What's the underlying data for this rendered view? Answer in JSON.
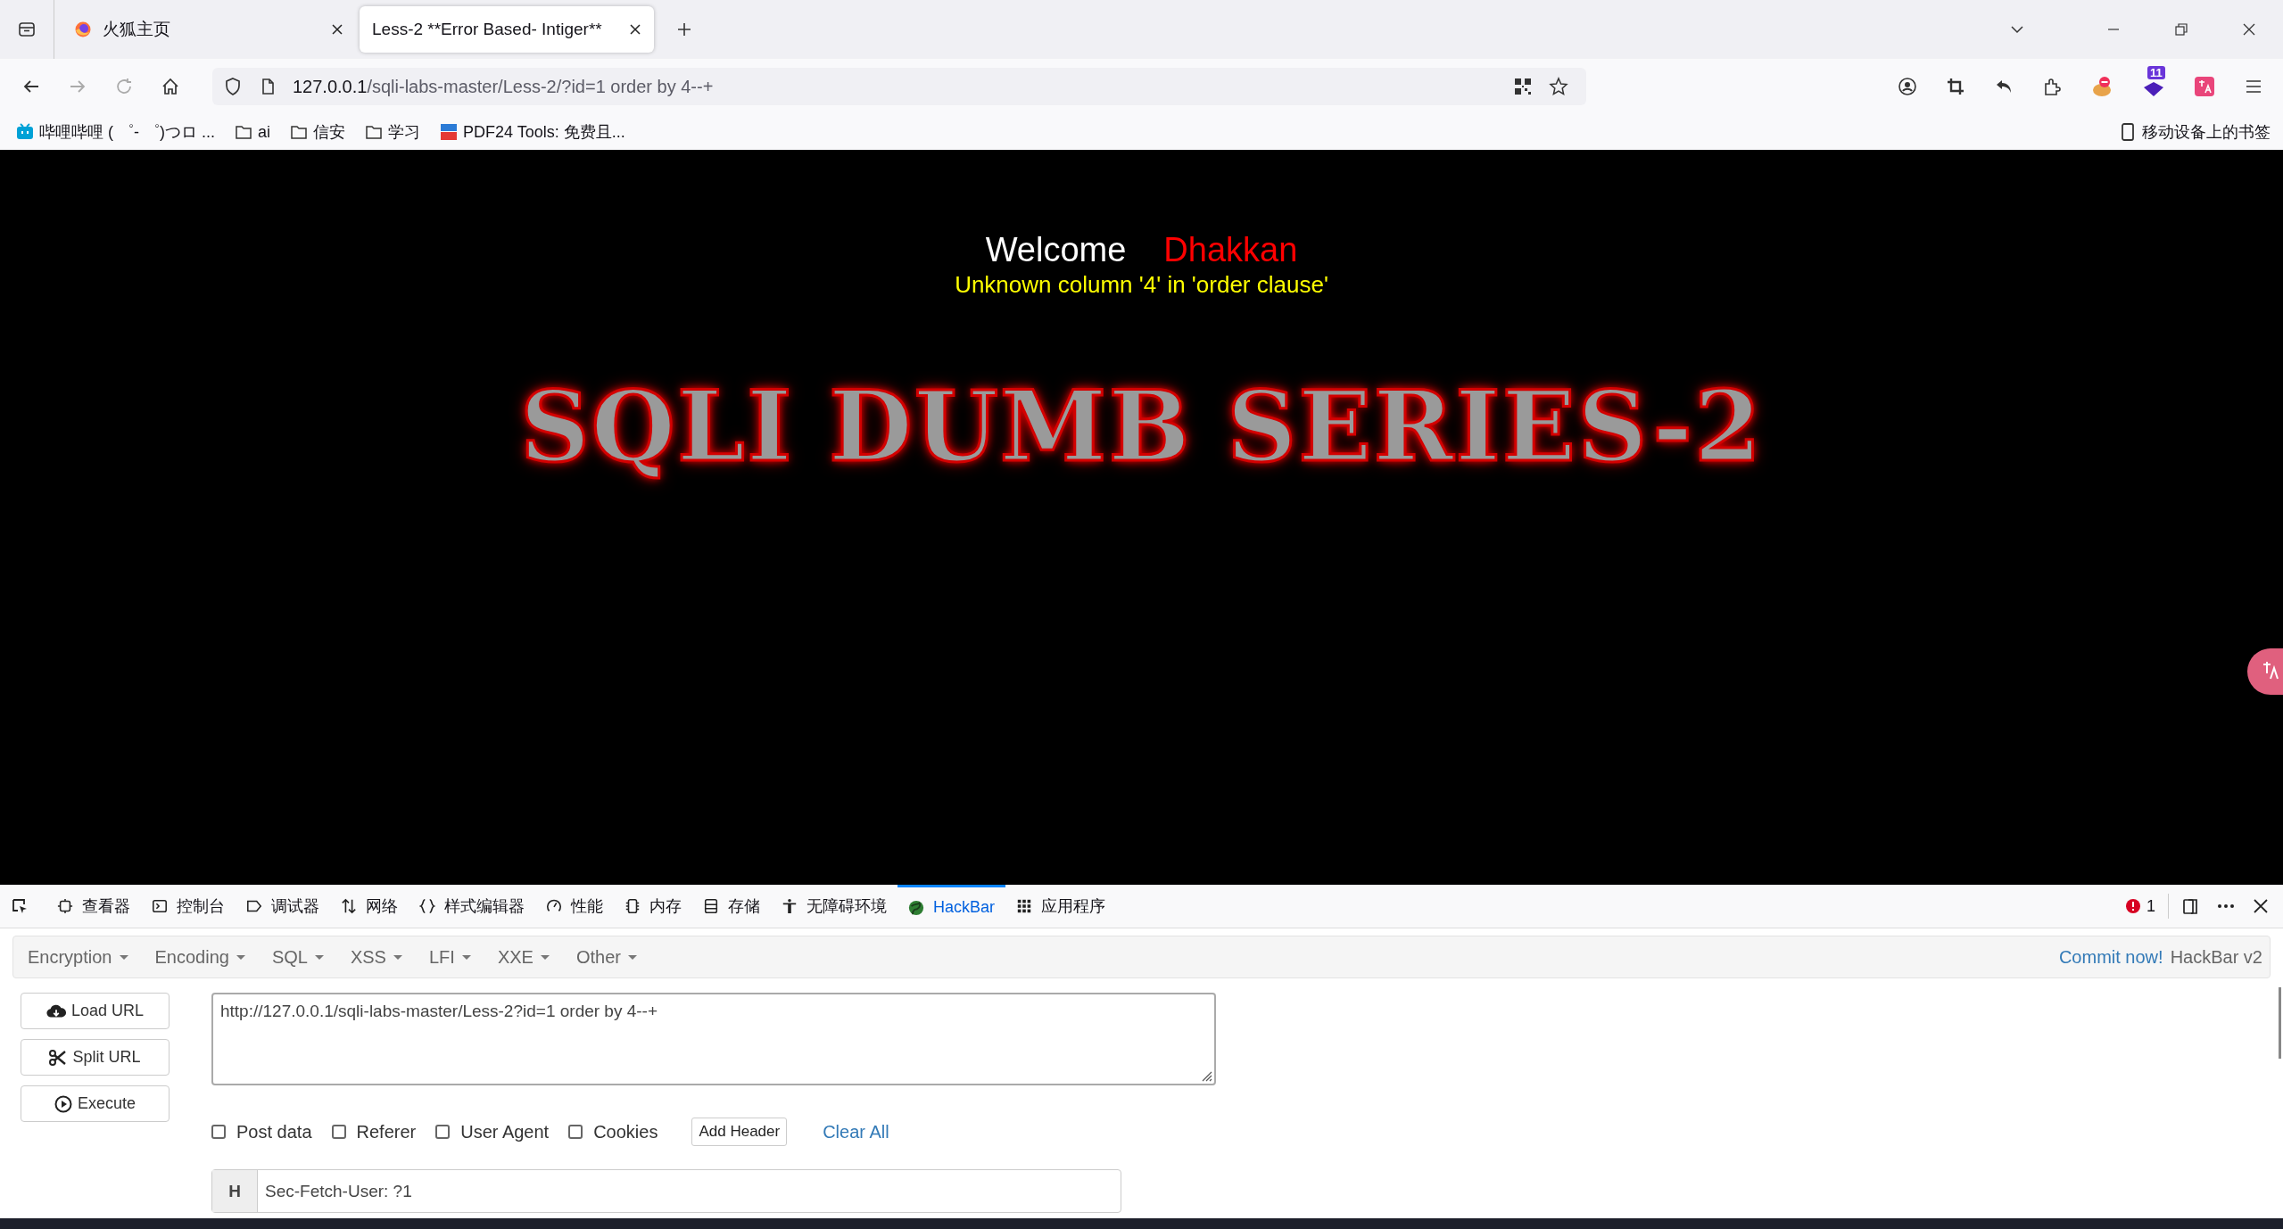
{
  "browser": {
    "tabs": [
      {
        "title": "火狐主页",
        "selected": false
      },
      {
        "title": "Less-2 **Error Based- Intiger**",
        "selected": true
      }
    ],
    "address": {
      "host": "127.0.0.1",
      "path": "/sqli-labs-master/Less-2/?id=1 order by 4--+"
    },
    "extension_badge": "11",
    "bookmarks": [
      {
        "label": "哔哩哔哩 ( ゜- ゜)つロ ...",
        "kind": "site"
      },
      {
        "label": "ai",
        "kind": "folder"
      },
      {
        "label": "信安",
        "kind": "folder"
      },
      {
        "label": "学习",
        "kind": "folder"
      },
      {
        "label": "PDF24 Tools: 免费且...",
        "kind": "pdf"
      }
    ],
    "mobile_bookmarks": "移动设备上的书签"
  },
  "page": {
    "welcome": "Welcome",
    "user": "Dhakkan",
    "error": "Unknown column '4' in 'order clause'",
    "banner": "SQLI DUMB SERIES-2"
  },
  "devtools": {
    "tabs": [
      {
        "label": "查看器",
        "kind": "inspector",
        "selected": false
      },
      {
        "label": "控制台",
        "kind": "console",
        "selected": false
      },
      {
        "label": "调试器",
        "kind": "debugger",
        "selected": false
      },
      {
        "label": "网络",
        "kind": "network",
        "selected": false
      },
      {
        "label": "样式编辑器",
        "kind": "style",
        "selected": false
      },
      {
        "label": "性能",
        "kind": "performance",
        "selected": false
      },
      {
        "label": "内存",
        "kind": "memory",
        "selected": false
      },
      {
        "label": "存储",
        "kind": "storage",
        "selected": false
      },
      {
        "label": "无障碍环境",
        "kind": "accessibility",
        "selected": false
      },
      {
        "label": "HackBar",
        "kind": "hackbar",
        "selected": true
      },
      {
        "label": "应用程序",
        "kind": "application",
        "selected": false
      }
    ],
    "error_count": "1"
  },
  "hackbar": {
    "menus": [
      "Encryption",
      "Encoding",
      "SQL",
      "XSS",
      "LFI",
      "XXE",
      "Other"
    ],
    "commit_link": "Commit now!",
    "version": "HackBar v2",
    "buttons": [
      {
        "label": "Load URL",
        "kind": "load"
      },
      {
        "label": "Split URL",
        "kind": "split"
      },
      {
        "label": "Execute",
        "kind": "execute"
      }
    ],
    "url": "http://127.0.0.1/sqli-labs-master/Less-2?id=1 order by 4--+",
    "options": [
      {
        "label": "Post data",
        "checked": false
      },
      {
        "label": "Referer",
        "checked": false
      },
      {
        "label": "User Agent",
        "checked": false
      },
      {
        "label": "Cookies",
        "checked": false
      }
    ],
    "add_header": "Add Header",
    "clear_all": "Clear All",
    "header": {
      "tag": "H",
      "value": "Sec-Fetch-User: ?1"
    }
  }
}
